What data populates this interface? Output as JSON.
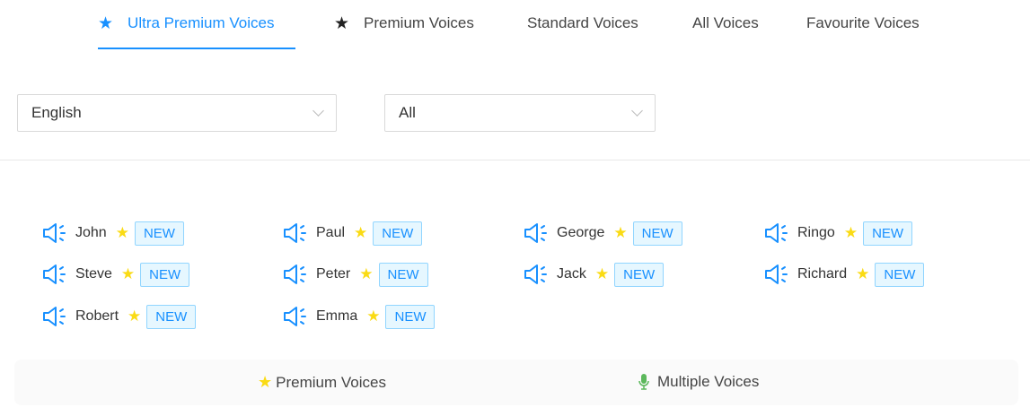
{
  "tabs": [
    {
      "label": "Ultra Premium Voices",
      "icon": "star-icon",
      "active": true
    },
    {
      "label": "Premium Voices",
      "icon": "star-icon"
    },
    {
      "label": "Standard Voices"
    },
    {
      "label": "All Voices"
    },
    {
      "label": "Favourite Voices"
    }
  ],
  "filters": {
    "language": "English",
    "gender": "All"
  },
  "voices": [
    {
      "name": "John",
      "badge": "NEW"
    },
    {
      "name": "Paul",
      "badge": "NEW"
    },
    {
      "name": "George",
      "badge": "NEW"
    },
    {
      "name": "Ringo",
      "badge": "NEW"
    },
    {
      "name": "Steve",
      "badge": "NEW"
    },
    {
      "name": "Peter",
      "badge": "NEW"
    },
    {
      "name": "Jack",
      "badge": "NEW"
    },
    {
      "name": "Richard",
      "badge": "NEW"
    },
    {
      "name": "Robert",
      "badge": "NEW"
    },
    {
      "name": "Emma",
      "badge": "NEW"
    }
  ],
  "legend": {
    "premium": "Premium Voices",
    "multiple": "Multiple Voices"
  },
  "colors": {
    "accent": "#1890ff",
    "star": "#fadb14",
    "mic": "#52c41a"
  }
}
